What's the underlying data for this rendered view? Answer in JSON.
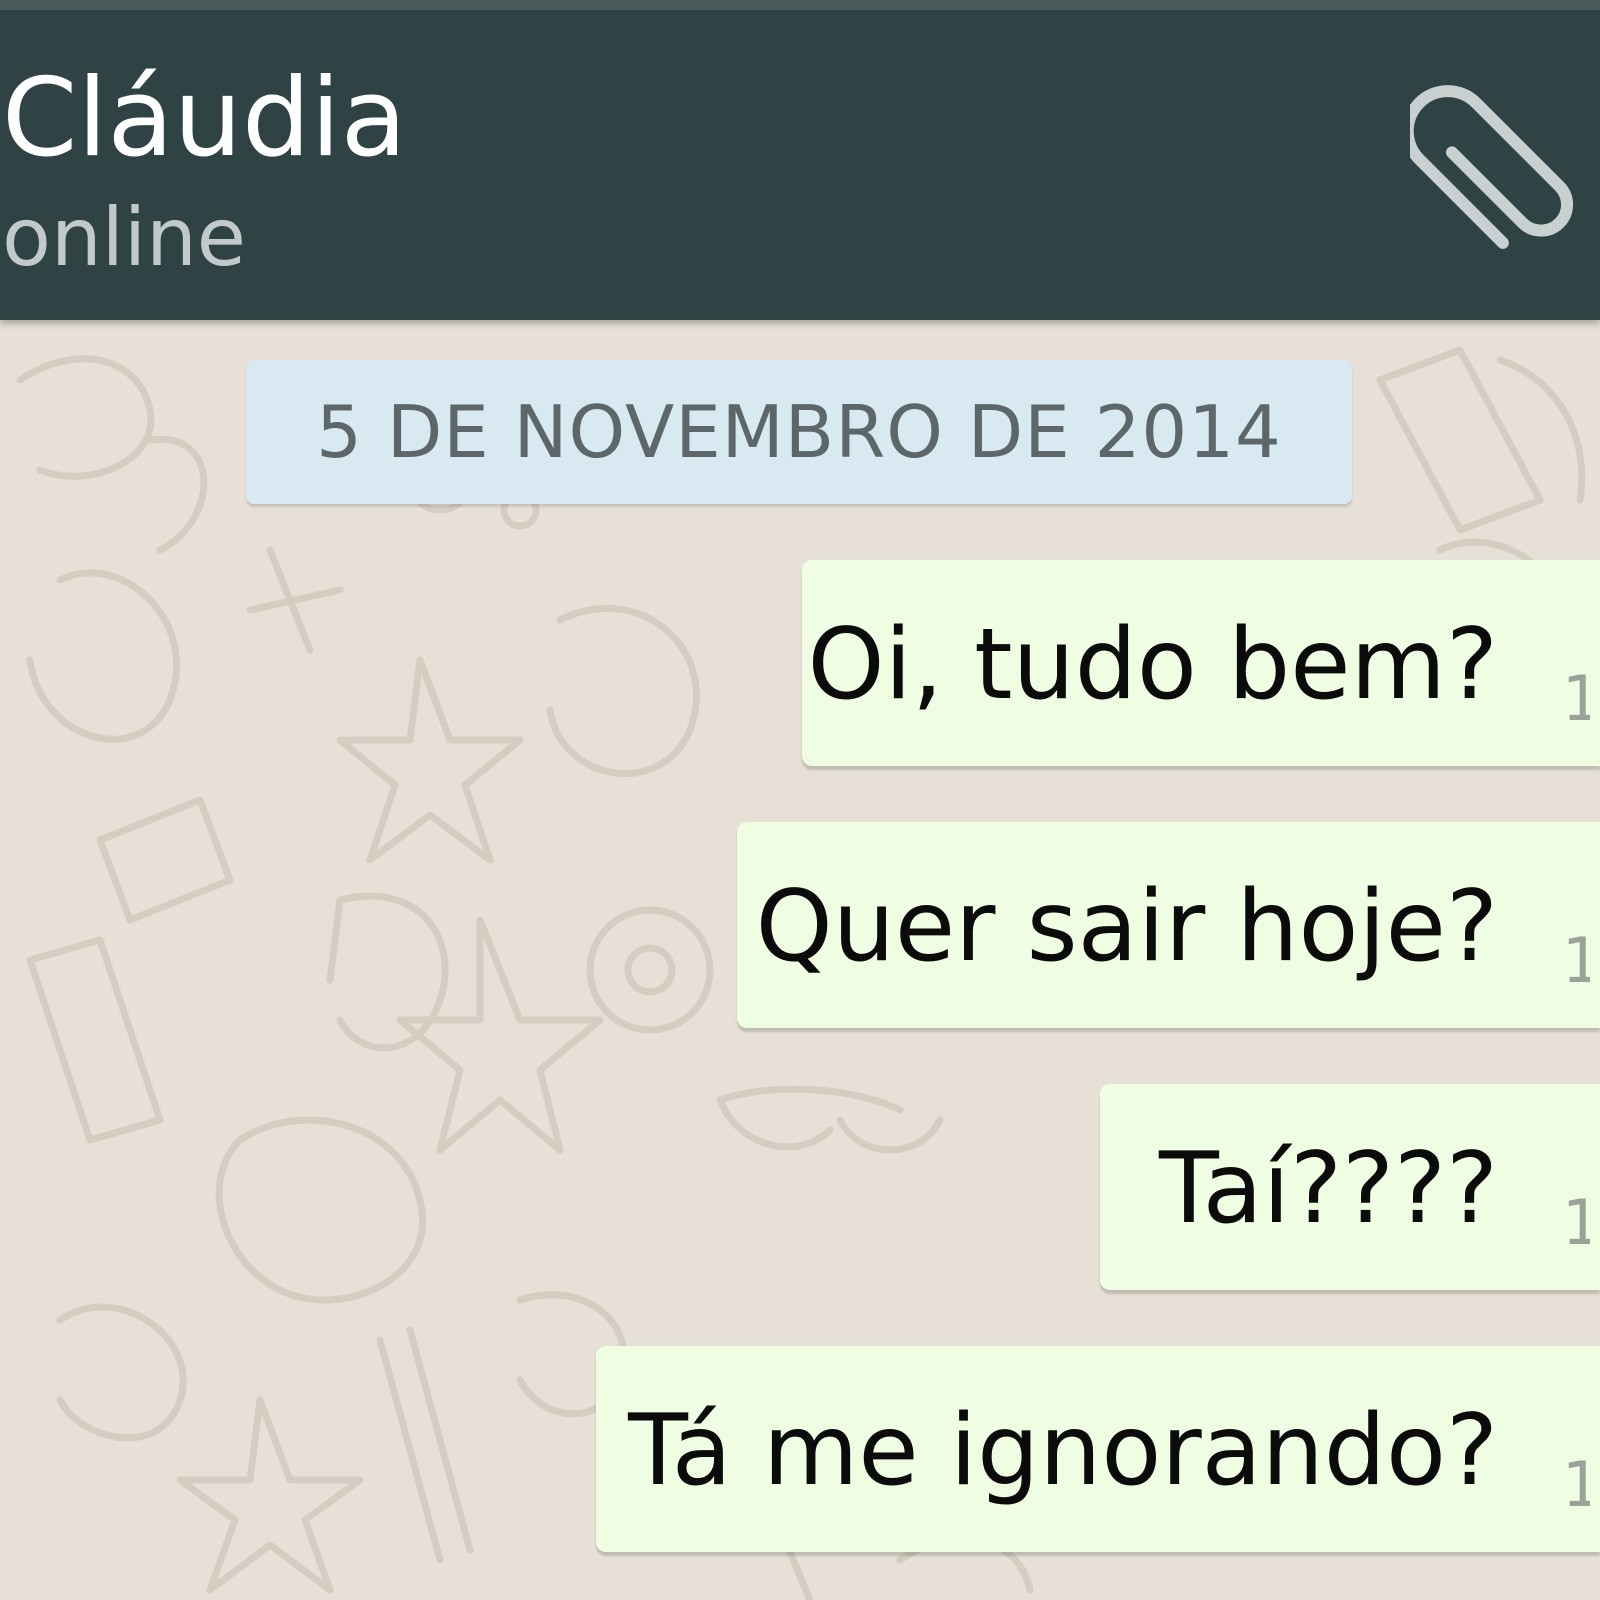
{
  "header": {
    "contact_name": "Cláudia",
    "status": "online",
    "attach_icon": "paperclip-icon",
    "background_color": "#2f4244"
  },
  "chat": {
    "date_separator": "5 DE NOVEMBRO DE 2014",
    "messages": [
      {
        "text": "Oi, tudo bem?",
        "time": "1"
      },
      {
        "text": "Quer sair hoje?",
        "time": "1"
      },
      {
        "text": "Taí????",
        "time": "1"
      },
      {
        "text": "Tá me ignorando?",
        "time": "1"
      }
    ],
    "bubble_color": "#effde3",
    "wallpaper_color": "#e6e0d6"
  }
}
